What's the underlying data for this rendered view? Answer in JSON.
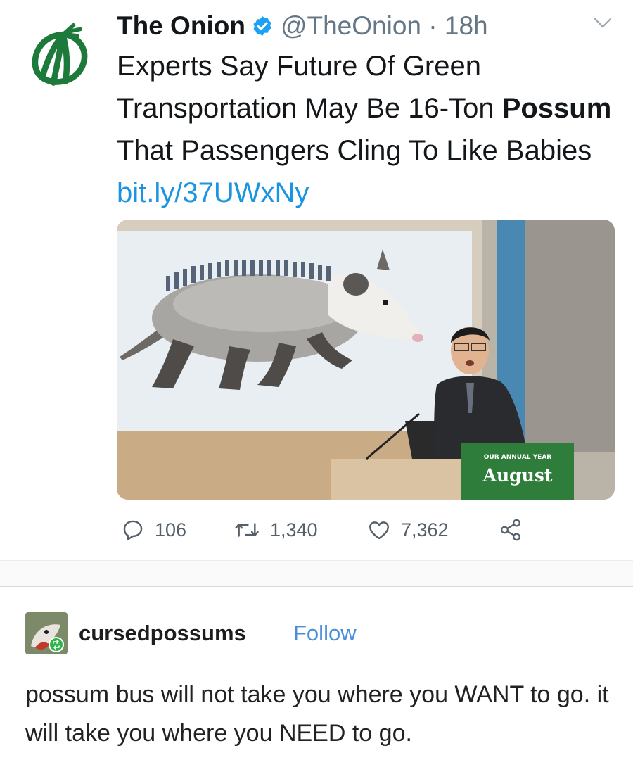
{
  "tweet": {
    "author_name": "The Onion",
    "handle_time": "@TheOnion · 18h",
    "text_part1": "Experts Say Future Of Green Transportation May Be 16-Ton ",
    "text_bold": "Possum",
    "text_part2": " That Passengers Cling To Like Babies ",
    "link": "bit.ly/37UWxNy",
    "media": {
      "banner_small": "OUR ANNUAL YEAR",
      "banner_large": "August"
    },
    "actions": {
      "replies": "106",
      "retweets": "1,340",
      "likes": "7,362"
    }
  },
  "tumblr_post": {
    "username": "cursedpossums",
    "follow_label": "Follow",
    "text": "possum bus will not take you where you WANT to go. it will take you where you NEED to go."
  },
  "colors": {
    "onion_green": "#1e7a3a",
    "link_blue": "#1b95e0",
    "tumblr_follow": "#4a8ed8"
  },
  "icons": [
    "onion-logo-icon",
    "verified-badge-icon",
    "chevron-down-icon",
    "reply-icon",
    "retweet-icon",
    "like-icon",
    "share-icon",
    "reblog-badge-icon"
  ]
}
